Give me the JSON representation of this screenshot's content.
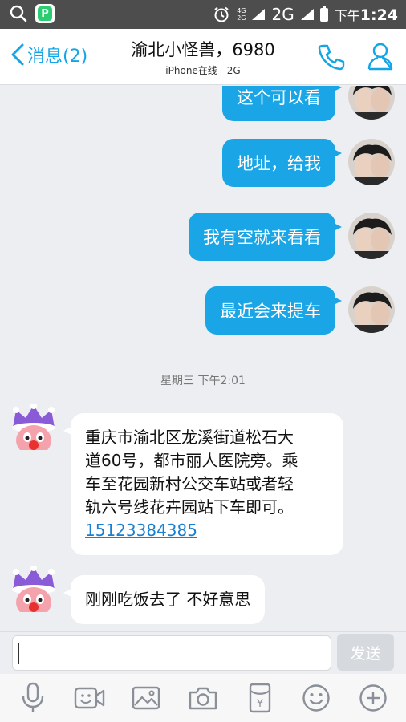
{
  "status_bar": {
    "network_top": "4G",
    "network_bottom": "2G",
    "network_type": "2G",
    "time_prefix": "下午",
    "time": "1:24"
  },
  "header": {
    "back_label": "消息(2)",
    "title": "渝北小怪兽，6980",
    "subtitle": "iPhone在线 - 2G",
    "accent_color": "#1aa6e6"
  },
  "messages_out": [
    {
      "text": "这个可以看"
    },
    {
      "text": "地址，给我"
    },
    {
      "text": "我有空就来看看"
    },
    {
      "text": "最近会来提车"
    }
  ],
  "time_divider": "星期三 下午2:01",
  "messages_in": [
    {
      "lines": [
        "重庆市渝北区龙溪街道松石大",
        "道60号，都市丽人医院旁。乘",
        "车至花园新村公交车站或者轻",
        "轨六号线花卉园站下车即可。"
      ],
      "phone": "15123384385"
    },
    {
      "text": "刚刚吃饭去了 不好意思"
    }
  ],
  "input": {
    "value": "",
    "send_label": "发送"
  },
  "toolbar": {
    "items": [
      "mic-icon",
      "video-icon",
      "image-icon",
      "camera-icon",
      "red-packet-icon",
      "emoji-icon",
      "plus-icon"
    ],
    "icon_color": "#8a8f98"
  }
}
